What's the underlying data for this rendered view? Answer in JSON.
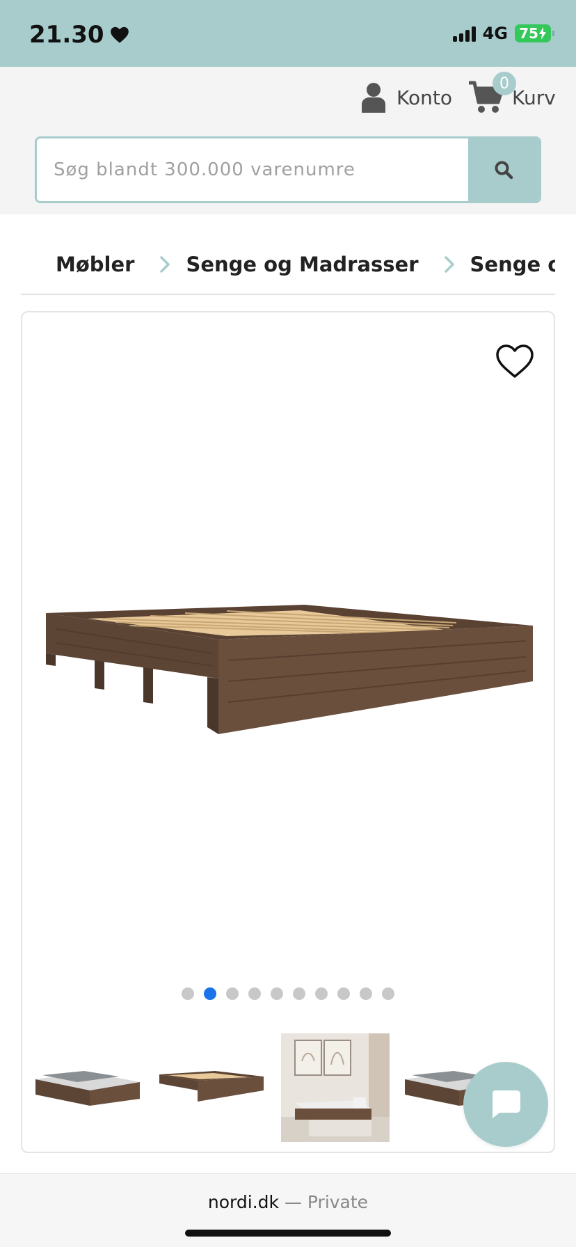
{
  "status_bar": {
    "time": "21.30",
    "network": "4G",
    "battery": "75"
  },
  "header": {
    "account_label": "Konto",
    "cart_label": "Kurv",
    "cart_count": "0",
    "search_placeholder": "Søg blandt 300.000 varenumre"
  },
  "breadcrumb": {
    "items": [
      "Møbler",
      "Senge og Madrasser",
      "Senge og S"
    ]
  },
  "gallery": {
    "dot_count": 10,
    "active_dot": 2
  },
  "footer": {
    "domain": "nordi.dk",
    "separator": " — ",
    "mode": "Private"
  },
  "colors": {
    "accent": "#a8cccc",
    "active_dot": "#1a73e8",
    "battery": "#34c759"
  }
}
